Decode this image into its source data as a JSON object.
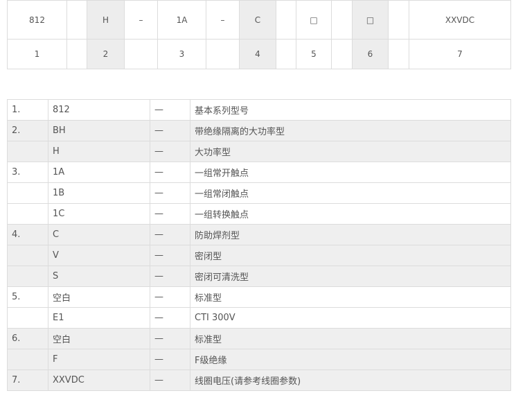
{
  "code_table": {
    "top_row": [
      "812",
      "",
      "H",
      "–",
      "1A",
      "–",
      "C",
      "",
      "□",
      "",
      "□",
      "",
      "XXVDC"
    ],
    "bottom_row": [
      "1",
      "",
      "2",
      "",
      "3",
      "",
      "4",
      "",
      "5",
      "",
      "6",
      "",
      "7"
    ]
  },
  "definitions": [
    {
      "num": "1.",
      "code": "812",
      "dash": "—",
      "desc": "基本系列型号"
    },
    {
      "num": "2.",
      "code": "BH",
      "dash": "—",
      "desc": "带绝缘隔离的大功率型"
    },
    {
      "num": "",
      "code": "H",
      "dash": "—",
      "desc": "大功率型"
    },
    {
      "num": "3.",
      "code": "1A",
      "dash": "—",
      "desc": "一组常开触点"
    },
    {
      "num": "",
      "code": "1B",
      "dash": "—",
      "desc": "一组常闭触点"
    },
    {
      "num": "",
      "code": "1C",
      "dash": "—",
      "desc": "一组转换触点"
    },
    {
      "num": "4.",
      "code": "C",
      "dash": "—",
      "desc": "防助焊剂型"
    },
    {
      "num": "",
      "code": "V",
      "dash": "—",
      "desc": "密闭型"
    },
    {
      "num": "",
      "code": "S",
      "dash": "—",
      "desc": "密闭可清洗型"
    },
    {
      "num": "5.",
      "code": "空白",
      "dash": "—",
      "desc": "标准型"
    },
    {
      "num": "",
      "code": "E1",
      "dash": "—",
      "desc": "CTI 300V"
    },
    {
      "num": "6.",
      "code": "空白",
      "dash": "—",
      "desc": "标准型"
    },
    {
      "num": "",
      "code": "F",
      "dash": "—",
      "desc": "F级绝缘"
    },
    {
      "num": "7.",
      "code": "XXVDC",
      "dash": "—",
      "desc": "线圈电压(请参考线圈参数)"
    }
  ]
}
